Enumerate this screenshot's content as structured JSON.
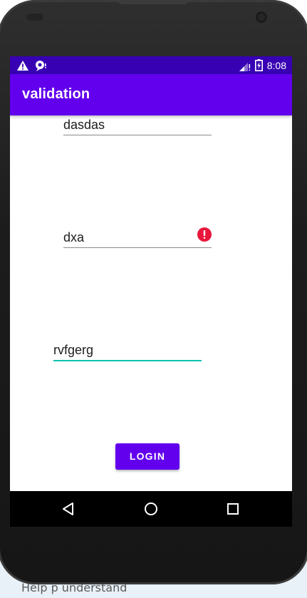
{
  "status_bar": {
    "time": "8:08",
    "left_icons": [
      "warning-icon",
      "notification-icon"
    ],
    "right_icons": [
      "signal-icon",
      "battery-icon"
    ]
  },
  "app_bar": {
    "title": "validation"
  },
  "form": {
    "field1_value": "dasdas",
    "field2_value": "dxa",
    "field2_has_error": true,
    "field3_value": "rvfgerg",
    "field3_focused": true
  },
  "login_button": {
    "label": "LOGIN"
  },
  "nav_bar": {
    "buttons": [
      "back-icon",
      "home-icon",
      "recents-icon"
    ]
  },
  "page_behind": {
    "text": "Help p                                         understand"
  },
  "colors": {
    "status_bar": "#3700b3",
    "app_bar": "#6200ee",
    "button": "#6200ee",
    "error": "#e8173b",
    "focus_underline": "#03c4b0"
  }
}
